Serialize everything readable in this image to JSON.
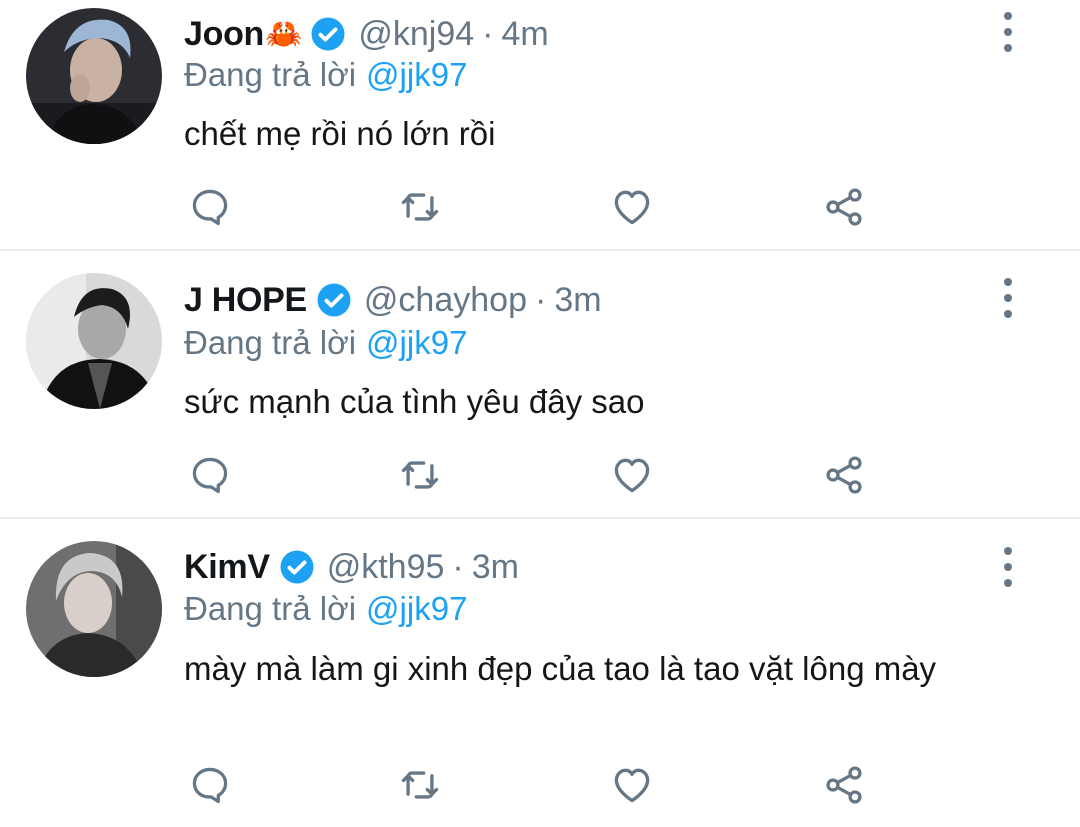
{
  "replying_label": "Đang trả lời",
  "colors": {
    "accent": "#1da1f2",
    "secondary": "#657786",
    "text": "#14171a",
    "divider": "#e6ecf0"
  },
  "tweets": [
    {
      "name": "Joon",
      "name_emoji": "🦀",
      "verified": true,
      "handle": "@knj94",
      "separator": "·",
      "time": "4m",
      "reply_to": "@jjk97",
      "text": "chết mẹ rồi nó lớn rồi"
    },
    {
      "name": "J HOPE",
      "name_emoji": "",
      "verified": true,
      "handle": "@chayhop",
      "separator": "·",
      "time": "3m",
      "reply_to": "@jjk97",
      "text": "sức mạnh của tình yêu đây sao"
    },
    {
      "name": "KimV",
      "name_emoji": "",
      "verified": true,
      "handle": "@kth95",
      "separator": "·",
      "time": "3m",
      "reply_to": "@jjk97",
      "text": "mày mà làm gi xinh đẹp của tao là tao vặt lông mày"
    }
  ],
  "icons": {
    "reply": "reply-icon",
    "retweet": "retweet-icon",
    "like": "heart-icon",
    "share": "share-icon",
    "more": "more-options-icon",
    "verified": "verified-badge-icon"
  }
}
